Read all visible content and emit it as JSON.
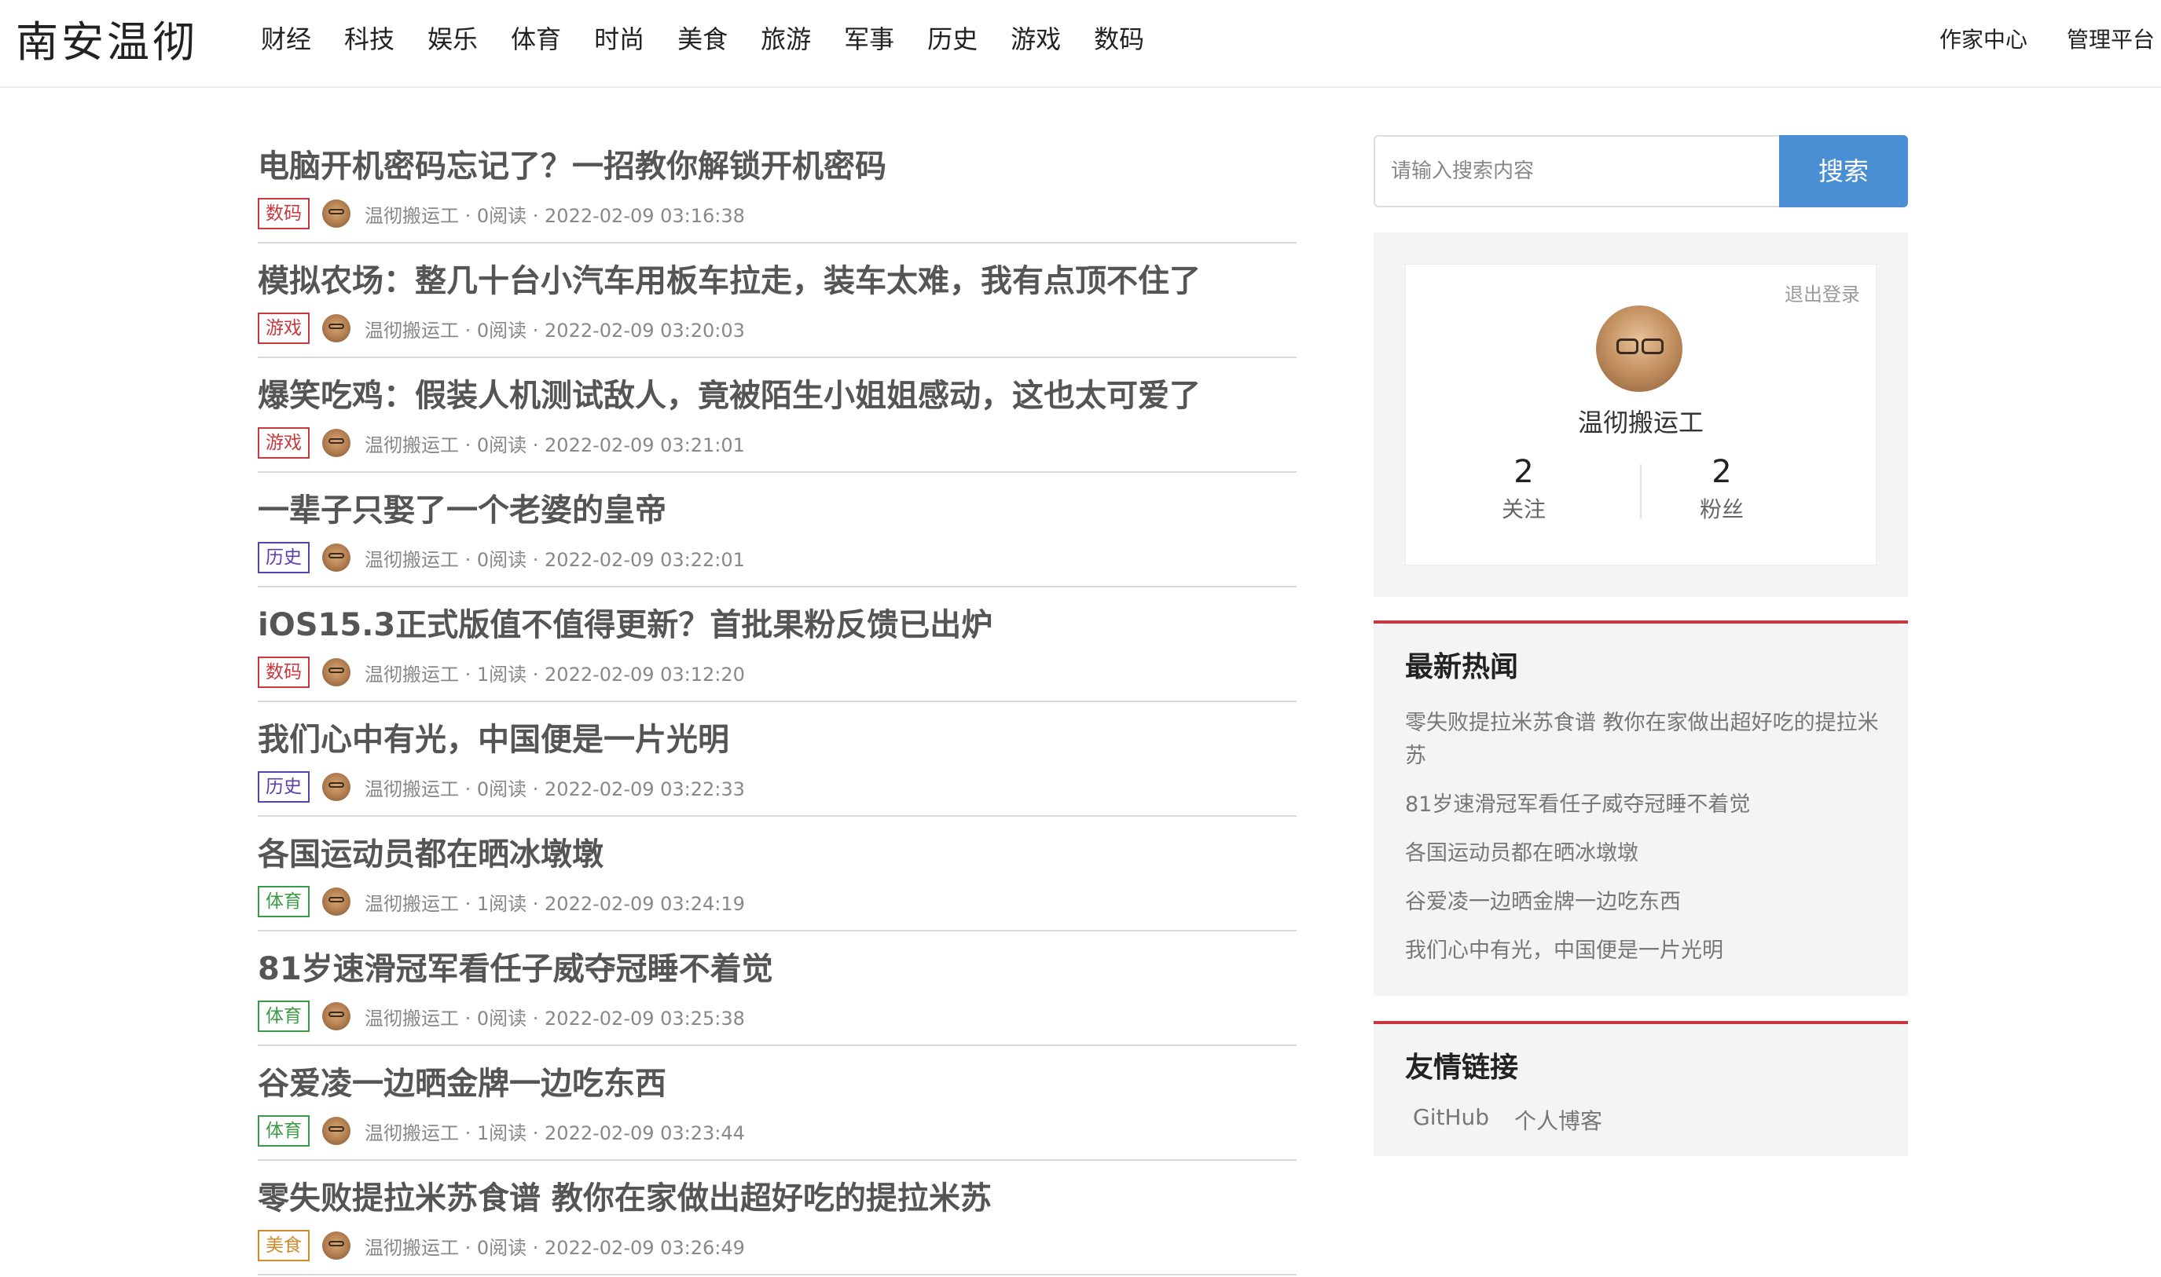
{
  "header": {
    "logo": "南安温彻",
    "nav": [
      "财经",
      "科技",
      "娱乐",
      "体育",
      "时尚",
      "美食",
      "旅游",
      "军事",
      "历史",
      "游戏",
      "数码"
    ],
    "right": [
      "作家中心",
      "管理平台"
    ]
  },
  "articles": [
    {
      "title": "电脑开机密码忘记了？一招教你解锁开机密码",
      "tag": "数码",
      "tag_color": "#c9383f",
      "meta": "温彻搬运工 · 0阅读 · 2022-02-09 03:16:38"
    },
    {
      "title": "模拟农场：整几十台小汽车用板车拉走，装车太难，我有点顶不住了",
      "tag": "游戏",
      "tag_color": "#c9383f",
      "meta": "温彻搬运工 · 0阅读 · 2022-02-09 03:20:03"
    },
    {
      "title": "爆笑吃鸡：假装人机测试敌人，竟被陌生小姐姐感动，这也太可爱了",
      "tag": "游戏",
      "tag_color": "#c9383f",
      "meta": "温彻搬运工 · 0阅读 · 2022-02-09 03:21:01"
    },
    {
      "title": "一辈子只娶了一个老婆的皇帝",
      "tag": "历史",
      "tag_color": "#5a3fb3",
      "meta": "温彻搬运工 · 0阅读 · 2022-02-09 03:22:01"
    },
    {
      "title": "iOS15.3正式版值不值得更新？首批果粉反馈已出炉",
      "tag": "数码",
      "tag_color": "#c9383f",
      "meta": "温彻搬运工 · 1阅读 · 2022-02-09 03:12:20"
    },
    {
      "title": "我们心中有光，中国便是一片光明",
      "tag": "历史",
      "tag_color": "#5a3fb3",
      "meta": "温彻搬运工 · 0阅读 · 2022-02-09 03:22:33"
    },
    {
      "title": "各国运动员都在晒冰墩墩",
      "tag": "体育",
      "tag_color": "#3a9a46",
      "meta": "温彻搬运工 · 1阅读 · 2022-02-09 03:24:19"
    },
    {
      "title": "81岁速滑冠军看任子威夺冠睡不着觉",
      "tag": "体育",
      "tag_color": "#3a9a46",
      "meta": "温彻搬运工 · 0阅读 · 2022-02-09 03:25:38"
    },
    {
      "title": "谷爱凌一边晒金牌一边吃东西",
      "tag": "体育",
      "tag_color": "#3a9a46",
      "meta": "温彻搬运工 · 1阅读 · 2022-02-09 03:23:44"
    },
    {
      "title": "零失败提拉米苏食谱 教你在家做出超好吃的提拉米苏",
      "tag": "美食",
      "tag_color": "#d08a2a",
      "meta": "温彻搬运工 · 0阅读 · 2022-02-09 03:26:49"
    }
  ],
  "search": {
    "placeholder": "请输入搜索内容",
    "button": "搜索"
  },
  "profile": {
    "logout": "退出登录",
    "username": "温彻搬运工",
    "follow_count": "2",
    "follow_label": "关注",
    "fans_count": "2",
    "fans_label": "粉丝"
  },
  "hot": {
    "title": "最新热闻",
    "items": [
      "零失败提拉米苏食谱 教你在家做出超好吃的提拉米苏",
      "81岁速滑冠军看任子威夺冠睡不着觉",
      "各国运动员都在晒冰墩墩",
      "谷爱凌一边晒金牌一边吃东西",
      "我们心中有光，中国便是一片光明"
    ]
  },
  "links": {
    "title": "友情链接",
    "items": [
      "GitHub",
      "个人博客"
    ]
  }
}
